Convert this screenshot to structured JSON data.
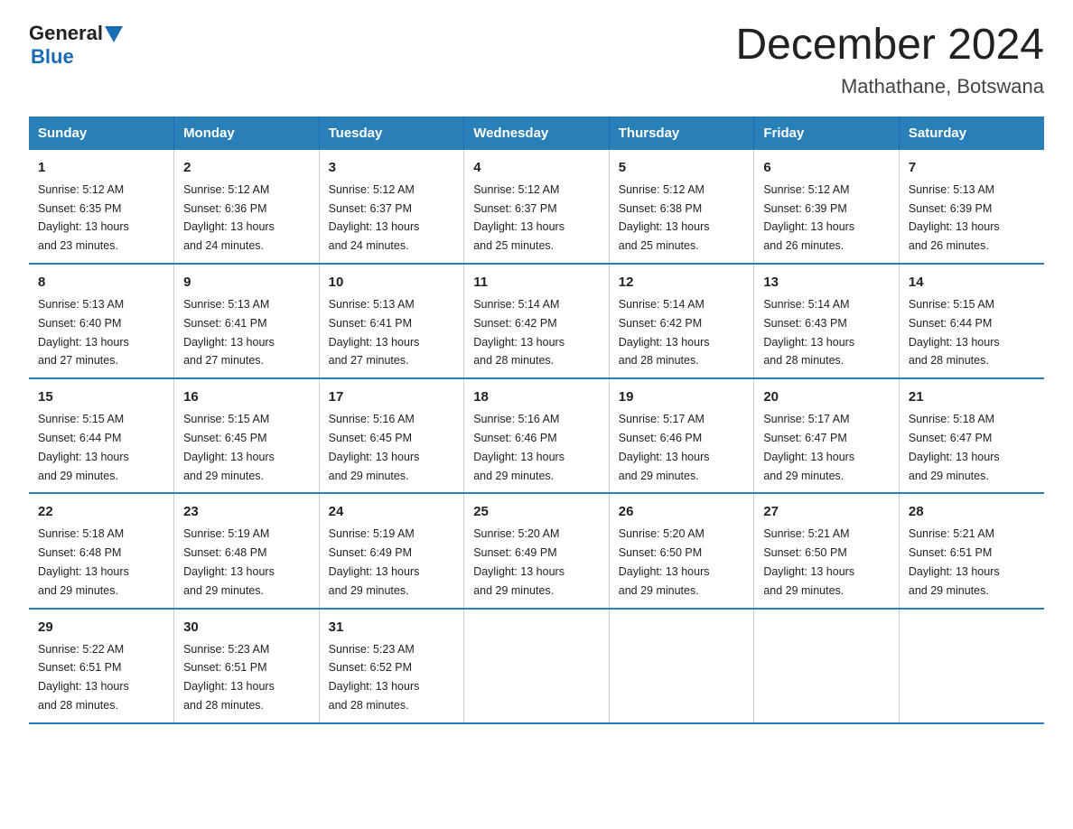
{
  "logo": {
    "general": "General",
    "blue": "Blue"
  },
  "header": {
    "month_title": "December 2024",
    "location": "Mathathane, Botswana"
  },
  "days_of_week": [
    "Sunday",
    "Monday",
    "Tuesday",
    "Wednesday",
    "Thursday",
    "Friday",
    "Saturday"
  ],
  "weeks": [
    [
      {
        "day": "1",
        "sunrise": "5:12 AM",
        "sunset": "6:35 PM",
        "daylight": "13 hours and 23 minutes."
      },
      {
        "day": "2",
        "sunrise": "5:12 AM",
        "sunset": "6:36 PM",
        "daylight": "13 hours and 24 minutes."
      },
      {
        "day": "3",
        "sunrise": "5:12 AM",
        "sunset": "6:37 PM",
        "daylight": "13 hours and 24 minutes."
      },
      {
        "day": "4",
        "sunrise": "5:12 AM",
        "sunset": "6:37 PM",
        "daylight": "13 hours and 25 minutes."
      },
      {
        "day": "5",
        "sunrise": "5:12 AM",
        "sunset": "6:38 PM",
        "daylight": "13 hours and 25 minutes."
      },
      {
        "day": "6",
        "sunrise": "5:12 AM",
        "sunset": "6:39 PM",
        "daylight": "13 hours and 26 minutes."
      },
      {
        "day": "7",
        "sunrise": "5:13 AM",
        "sunset": "6:39 PM",
        "daylight": "13 hours and 26 minutes."
      }
    ],
    [
      {
        "day": "8",
        "sunrise": "5:13 AM",
        "sunset": "6:40 PM",
        "daylight": "13 hours and 27 minutes."
      },
      {
        "day": "9",
        "sunrise": "5:13 AM",
        "sunset": "6:41 PM",
        "daylight": "13 hours and 27 minutes."
      },
      {
        "day": "10",
        "sunrise": "5:13 AM",
        "sunset": "6:41 PM",
        "daylight": "13 hours and 27 minutes."
      },
      {
        "day": "11",
        "sunrise": "5:14 AM",
        "sunset": "6:42 PM",
        "daylight": "13 hours and 28 minutes."
      },
      {
        "day": "12",
        "sunrise": "5:14 AM",
        "sunset": "6:42 PM",
        "daylight": "13 hours and 28 minutes."
      },
      {
        "day": "13",
        "sunrise": "5:14 AM",
        "sunset": "6:43 PM",
        "daylight": "13 hours and 28 minutes."
      },
      {
        "day": "14",
        "sunrise": "5:15 AM",
        "sunset": "6:44 PM",
        "daylight": "13 hours and 28 minutes."
      }
    ],
    [
      {
        "day": "15",
        "sunrise": "5:15 AM",
        "sunset": "6:44 PM",
        "daylight": "13 hours and 29 minutes."
      },
      {
        "day": "16",
        "sunrise": "5:15 AM",
        "sunset": "6:45 PM",
        "daylight": "13 hours and 29 minutes."
      },
      {
        "day": "17",
        "sunrise": "5:16 AM",
        "sunset": "6:45 PM",
        "daylight": "13 hours and 29 minutes."
      },
      {
        "day": "18",
        "sunrise": "5:16 AM",
        "sunset": "6:46 PM",
        "daylight": "13 hours and 29 minutes."
      },
      {
        "day": "19",
        "sunrise": "5:17 AM",
        "sunset": "6:46 PM",
        "daylight": "13 hours and 29 minutes."
      },
      {
        "day": "20",
        "sunrise": "5:17 AM",
        "sunset": "6:47 PM",
        "daylight": "13 hours and 29 minutes."
      },
      {
        "day": "21",
        "sunrise": "5:18 AM",
        "sunset": "6:47 PM",
        "daylight": "13 hours and 29 minutes."
      }
    ],
    [
      {
        "day": "22",
        "sunrise": "5:18 AM",
        "sunset": "6:48 PM",
        "daylight": "13 hours and 29 minutes."
      },
      {
        "day": "23",
        "sunrise": "5:19 AM",
        "sunset": "6:48 PM",
        "daylight": "13 hours and 29 minutes."
      },
      {
        "day": "24",
        "sunrise": "5:19 AM",
        "sunset": "6:49 PM",
        "daylight": "13 hours and 29 minutes."
      },
      {
        "day": "25",
        "sunrise": "5:20 AM",
        "sunset": "6:49 PM",
        "daylight": "13 hours and 29 minutes."
      },
      {
        "day": "26",
        "sunrise": "5:20 AM",
        "sunset": "6:50 PM",
        "daylight": "13 hours and 29 minutes."
      },
      {
        "day": "27",
        "sunrise": "5:21 AM",
        "sunset": "6:50 PM",
        "daylight": "13 hours and 29 minutes."
      },
      {
        "day": "28",
        "sunrise": "5:21 AM",
        "sunset": "6:51 PM",
        "daylight": "13 hours and 29 minutes."
      }
    ],
    [
      {
        "day": "29",
        "sunrise": "5:22 AM",
        "sunset": "6:51 PM",
        "daylight": "13 hours and 28 minutes."
      },
      {
        "day": "30",
        "sunrise": "5:23 AM",
        "sunset": "6:51 PM",
        "daylight": "13 hours and 28 minutes."
      },
      {
        "day": "31",
        "sunrise": "5:23 AM",
        "sunset": "6:52 PM",
        "daylight": "13 hours and 28 minutes."
      },
      null,
      null,
      null,
      null
    ]
  ],
  "labels": {
    "sunrise": "Sunrise:",
    "sunset": "Sunset:",
    "daylight": "Daylight:"
  }
}
